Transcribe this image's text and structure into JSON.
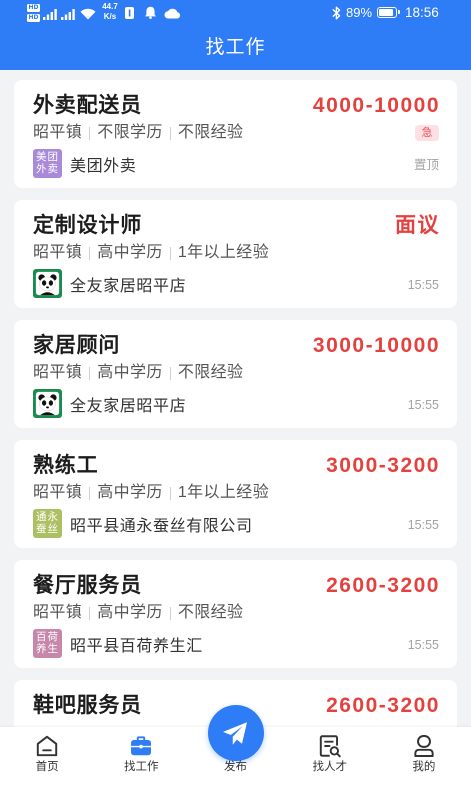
{
  "colors": {
    "primary": "#2e7cf6",
    "salary": "#e4423f",
    "page_bg": "#f2f3f5",
    "urgent_bg": "#fde0e3",
    "urgent_text": "#e8545a"
  },
  "status_bar": {
    "hd_badges": [
      "HD",
      "HD"
    ],
    "net_speed": {
      "value": "44.7",
      "unit": "K/s"
    },
    "icons": [
      "signal-icon",
      "signal-icon",
      "wifi-icon",
      "app-notification-icon",
      "bell-icon",
      "cloud-icon",
      "bluetooth-icon",
      "battery-icon"
    ],
    "battery_percent": "89%",
    "battery_level": 0.89,
    "time": "18:56"
  },
  "header": {
    "title": "找工作"
  },
  "jobs": [
    {
      "title": "外卖配送员",
      "salary": "4000-10000",
      "location": "昭平镇",
      "education": "不限学历",
      "experience": "不限经验",
      "urgent_label": "急",
      "company": "美团外卖",
      "logo": {
        "lines": [
          "美团",
          "外卖"
        ],
        "color": "#a98ad8"
      },
      "pinned": "置顶"
    },
    {
      "title": "定制设计师",
      "salary": "面议",
      "location": "昭平镇",
      "education": "高中学历",
      "experience": "1年以上经验",
      "company": "全友家居昭平店",
      "logo": {
        "icon": "panda-logo-icon",
        "color": "#1a8c4e"
      },
      "posted_time": "15:55"
    },
    {
      "title": "家居顾问",
      "salary": "3000-10000",
      "location": "昭平镇",
      "education": "高中学历",
      "experience": "不限经验",
      "company": "全友家居昭平店",
      "logo": {
        "icon": "panda-logo-icon",
        "color": "#1a8c4e"
      },
      "posted_time": "15:55"
    },
    {
      "title": "熟练工",
      "salary": "3000-3200",
      "location": "昭平镇",
      "education": "高中学历",
      "experience": "1年以上经验",
      "company": "昭平县通永蚕丝有限公司",
      "logo": {
        "lines": [
          "通永",
          "蚕丝"
        ],
        "color": "#abc062"
      },
      "posted_time": "15:55"
    },
    {
      "title": "餐厅服务员",
      "salary": "2600-3200",
      "location": "昭平镇",
      "education": "高中学历",
      "experience": "不限经验",
      "company": "昭平县百荷养生汇",
      "logo": {
        "lines": [
          "百荷",
          "养生"
        ],
        "color": "#c687aa"
      },
      "posted_time": "15:55"
    },
    {
      "title": "鞋吧服务员",
      "salary": "2600-3200"
    }
  ],
  "tabbar": {
    "items": [
      {
        "label": "首页",
        "icon": "home-icon",
        "active": false
      },
      {
        "label": "找工作",
        "icon": "briefcase-icon",
        "active": true
      },
      {
        "label": "发布",
        "icon": "paper-plane-icon",
        "active": false
      },
      {
        "label": "找人才",
        "icon": "talent-search-icon",
        "active": false
      },
      {
        "label": "我的",
        "icon": "profile-icon",
        "active": false
      }
    ]
  }
}
